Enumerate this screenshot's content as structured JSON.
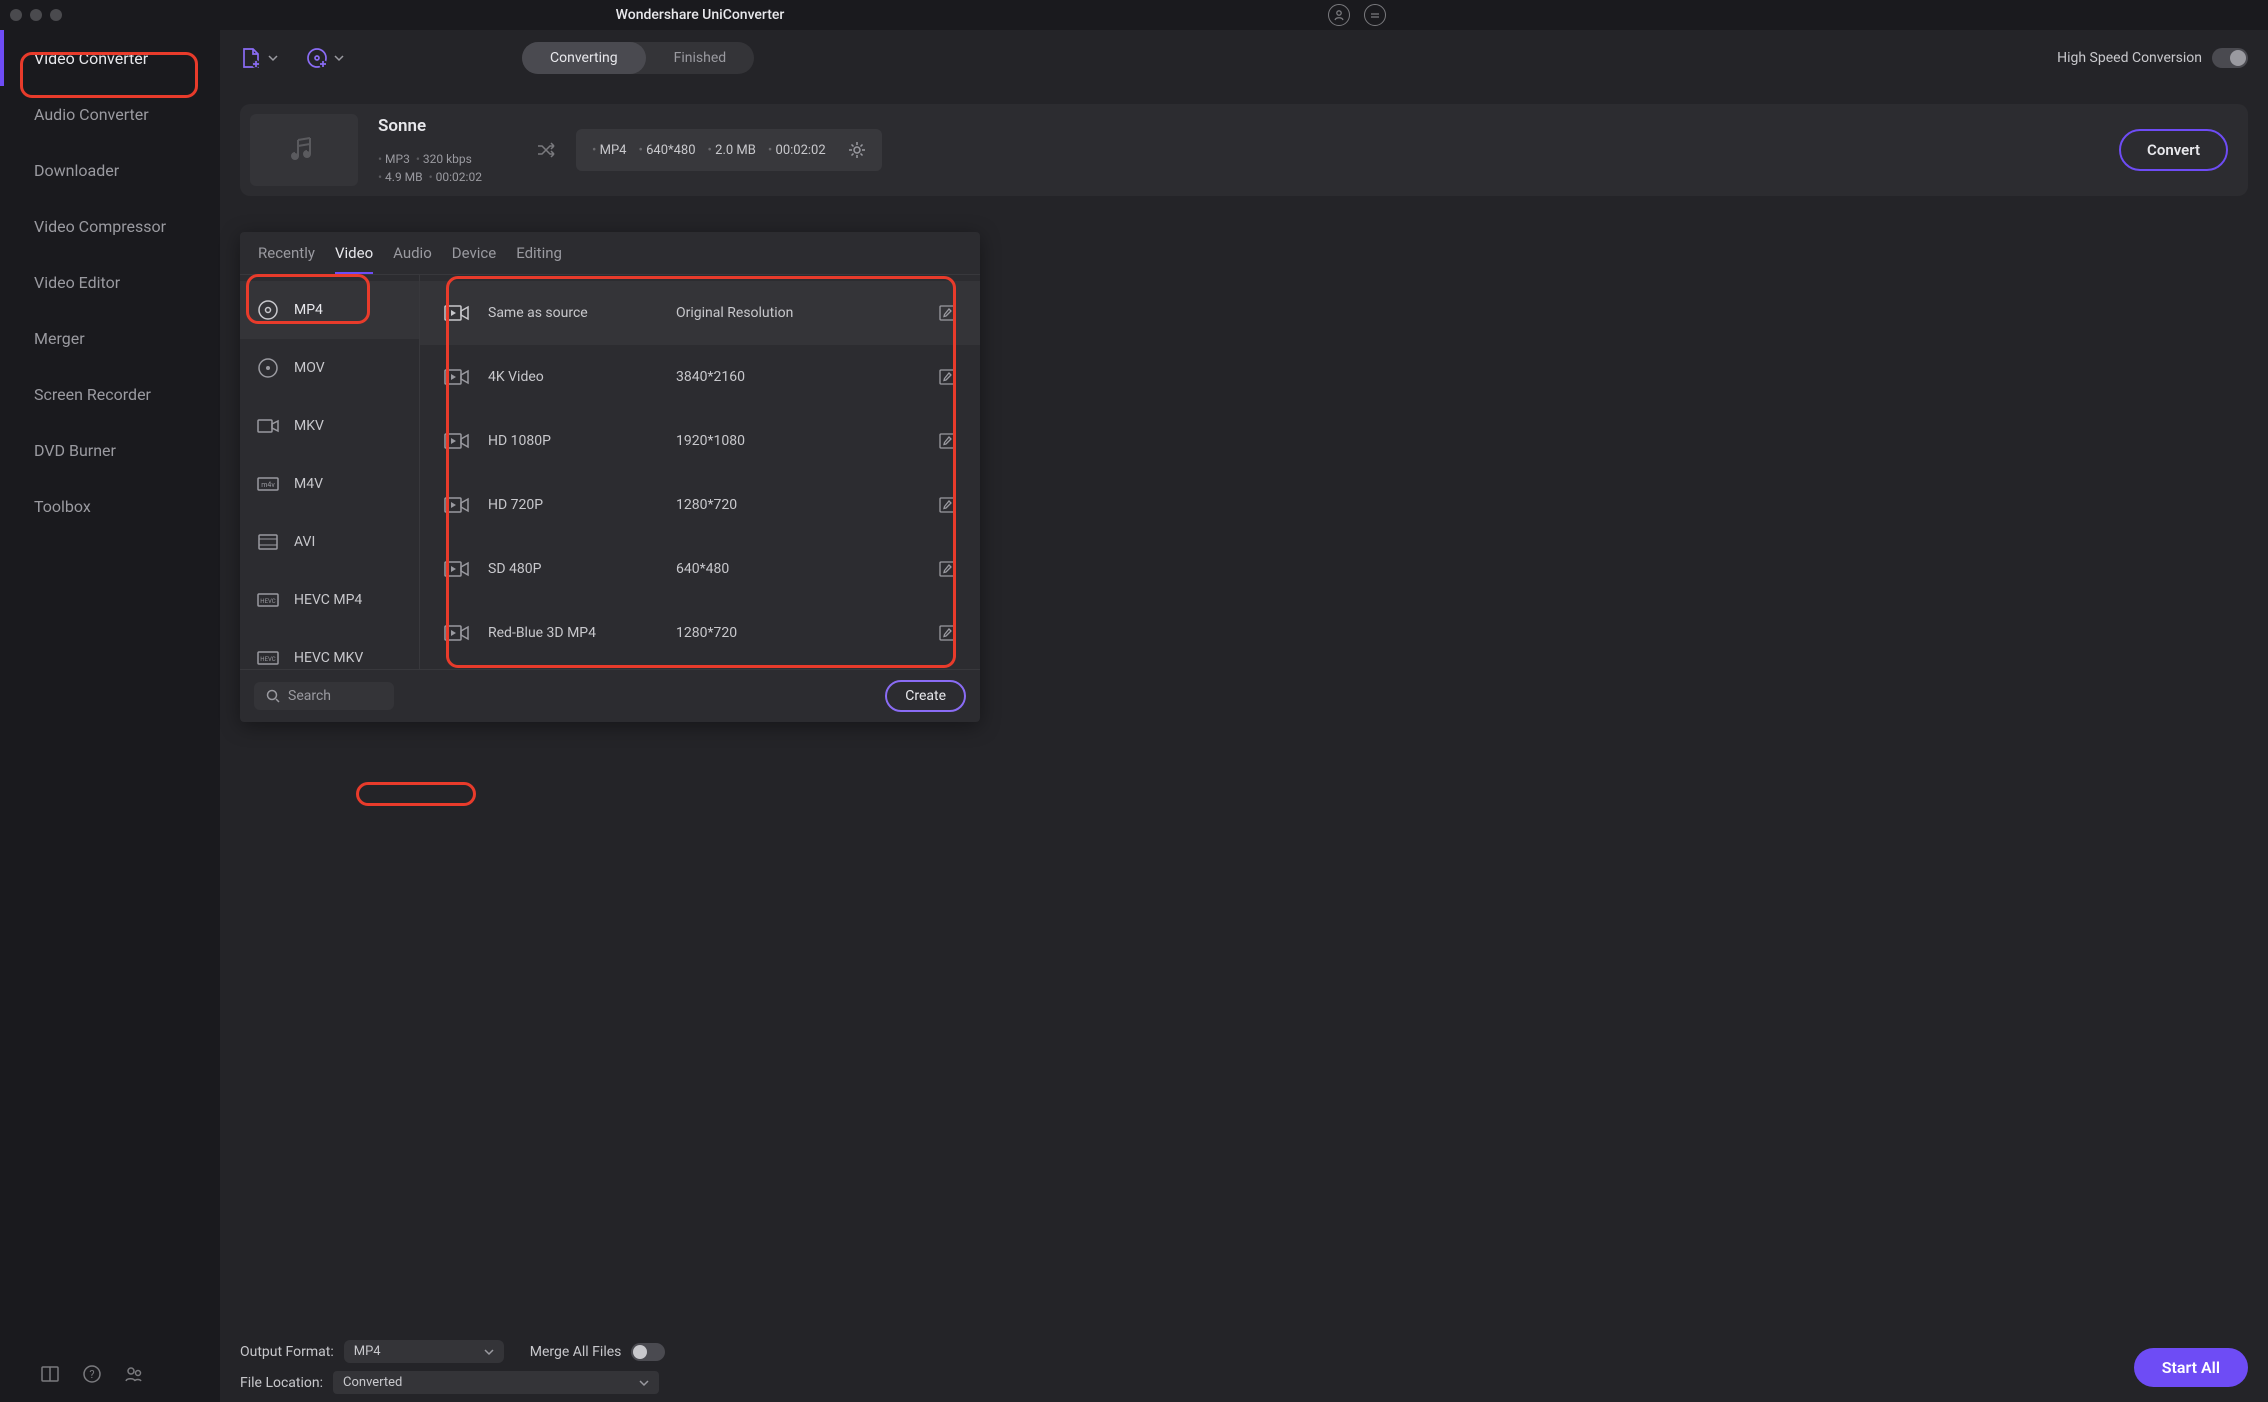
{
  "app_title": "Wondershare UniConverter",
  "sidebar": {
    "items": [
      {
        "label": "Video Converter"
      },
      {
        "label": "Audio Converter"
      },
      {
        "label": "Downloader"
      },
      {
        "label": "Video Compressor"
      },
      {
        "label": "Video Editor"
      },
      {
        "label": "Merger"
      },
      {
        "label": "Screen Recorder"
      },
      {
        "label": "DVD Burner"
      },
      {
        "label": "Toolbox"
      }
    ]
  },
  "toolbar": {
    "segments": {
      "converting": "Converting",
      "finished": "Finished"
    },
    "hs_label": "High Speed Conversion"
  },
  "file": {
    "title": "Sonne",
    "src": {
      "format": "MP3",
      "bitrate": "320 kbps",
      "size": "4.9 MB",
      "duration": "00:02:02"
    },
    "dst": {
      "format": "MP4",
      "resolution": "640*480",
      "size": "2.0 MB",
      "duration": "00:02:02"
    },
    "convert_btn": "Convert"
  },
  "popup": {
    "tabs": [
      "Recently",
      "Video",
      "Audio",
      "Device",
      "Editing"
    ],
    "formats": [
      "MP4",
      "MOV",
      "MKV",
      "M4V",
      "AVI",
      "HEVC MP4",
      "HEVC MKV"
    ],
    "resolutions": [
      {
        "name": "Same as source",
        "val": "Original Resolution"
      },
      {
        "name": "4K Video",
        "val": "3840*2160"
      },
      {
        "name": "HD 1080P",
        "val": "1920*1080"
      },
      {
        "name": "HD 720P",
        "val": "1280*720"
      },
      {
        "name": "SD 480P",
        "val": "640*480"
      },
      {
        "name": "Red-Blue 3D MP4",
        "val": "1280*720"
      }
    ],
    "search_placeholder": "Search",
    "create_btn": "Create"
  },
  "bottom": {
    "output_format_label": "Output Format:",
    "output_format_value": "MP4",
    "merge_label": "Merge All Files",
    "file_location_label": "File Location:",
    "file_location_value": "Converted",
    "start_btn": "Start All"
  }
}
